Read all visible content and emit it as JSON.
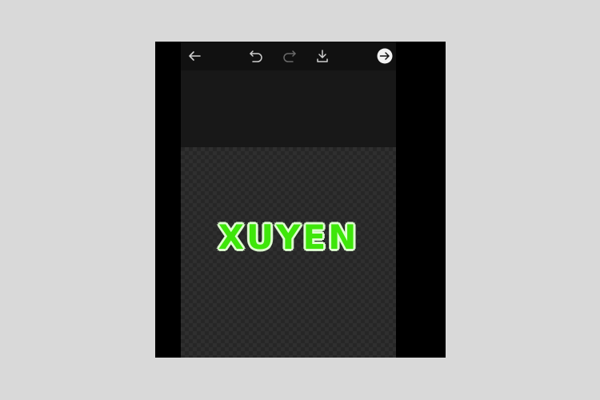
{
  "toolbar": {
    "icons": [
      "back-arrow-icon",
      "undo-icon",
      "redo-icon",
      "download-icon",
      "next-arrow-icon"
    ]
  },
  "canvas": {
    "sticker_text": "XUYEN",
    "text_color": "#3ee60a",
    "outline_color": "#dfffd0"
  },
  "colors": {
    "page_background": "#d9d9d9",
    "device_frame": "#000000",
    "toolbar_background": "#111111"
  }
}
